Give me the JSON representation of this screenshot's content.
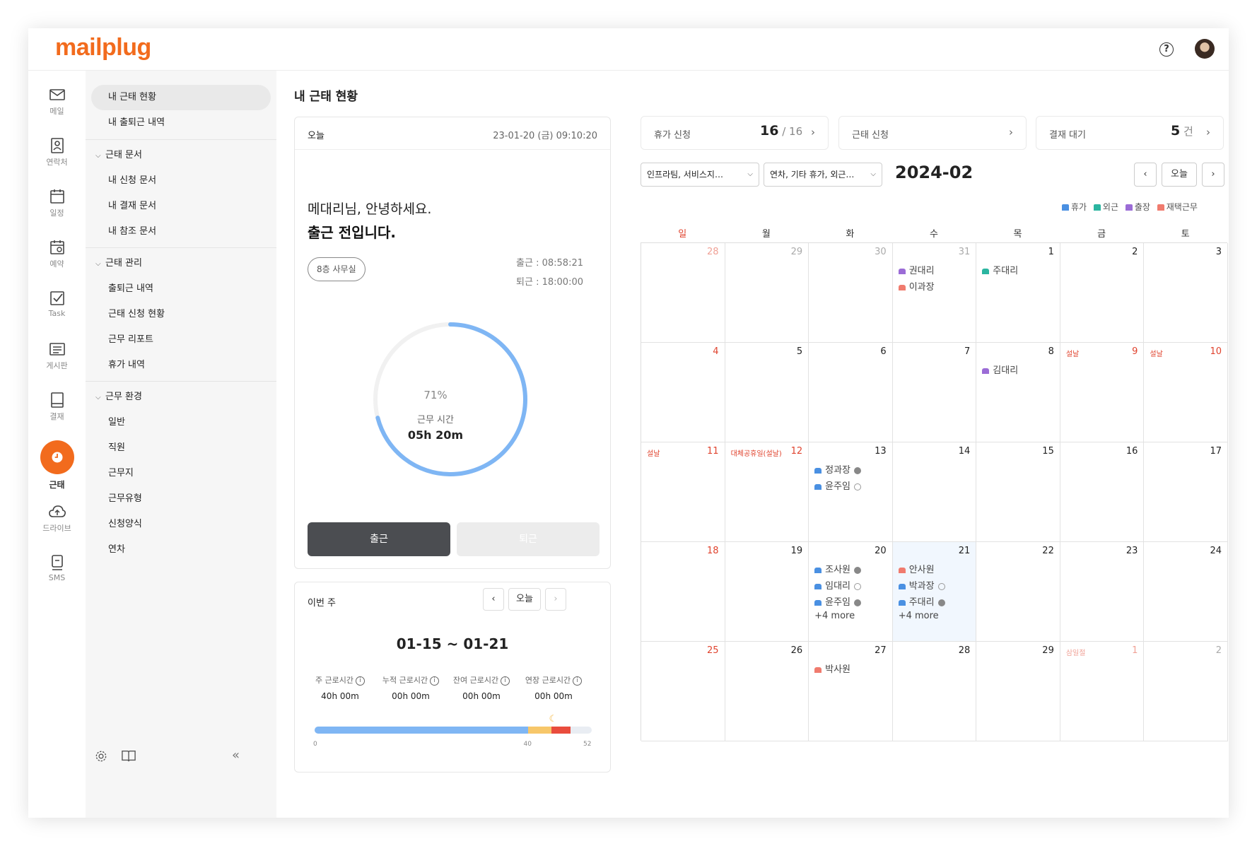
{
  "app": {
    "logo": "mailplug"
  },
  "rail": [
    {
      "label": "메일",
      "icon": "mail-icon"
    },
    {
      "label": "연락처",
      "icon": "contacts-icon"
    },
    {
      "label": "일정",
      "icon": "calendar-icon"
    },
    {
      "label": "예약",
      "icon": "reservation-icon"
    },
    {
      "label": "Task",
      "icon": "task-icon"
    },
    {
      "label": "게시판",
      "icon": "board-icon"
    },
    {
      "label": "결재",
      "icon": "approval-icon"
    },
    {
      "label": "근태",
      "icon": "clock-icon"
    },
    {
      "label": "드라이브",
      "icon": "cloud-icon"
    },
    {
      "label": "SMS",
      "icon": "sms-icon"
    }
  ],
  "subnav": {
    "top": [
      "내 근태 현황",
      "내 출퇴근 내역"
    ],
    "groups": [
      {
        "title": "근태 문서",
        "items": [
          "내 신청 문서",
          "내 결재 문서",
          "내 참조 문서"
        ]
      },
      {
        "title": "근태 관리",
        "items": [
          "출퇴근 내역",
          "근태 신청 현황",
          "근무 리포트",
          "휴가 내역"
        ]
      },
      {
        "title": "근무 환경",
        "items": [
          "일반",
          "직원",
          "근무지",
          "근무유형",
          "신청양식",
          "연차"
        ]
      }
    ]
  },
  "page": {
    "title": "내 근태 현황"
  },
  "today": {
    "label": "오늘",
    "datetime": "23-01-20 (금) 09:10:20",
    "greeting": "메대리님, 안녕하세요.",
    "status": "출근 전입니다.",
    "location": "8층 사무실",
    "clock_in": "출근 : 08:58:21",
    "clock_out": "퇴근 : 18:00:00",
    "progress_pct": 71,
    "progress_text": "71%",
    "work_label": "근무 시간",
    "work_value": "05h 20m",
    "btn_in": "출근",
    "btn_out": "퇴근"
  },
  "week": {
    "label": "이번 주",
    "today_btn": "오늘",
    "range": "01-15 ~ 01-21",
    "stats": [
      {
        "label": "주 근로시간",
        "value": "40h 00m"
      },
      {
        "label": "누적 근로시간",
        "value": "00h 00m"
      },
      {
        "label": "잔여 근로시간",
        "value": "00h 00m"
      },
      {
        "label": "연장 근로시간",
        "value": "00h 00m"
      }
    ],
    "bar": {
      "max": 52,
      "fill": 40,
      "extra1": 4.5,
      "extra2": 3.5
    },
    "ticks": [
      "0",
      "40",
      "52"
    ]
  },
  "summary": {
    "leave": {
      "label": "휴가 신청",
      "num": "16",
      "sub": " / 16"
    },
    "attendance": {
      "label": "근태 신청"
    },
    "pending": {
      "label": "결재 대기",
      "num": "5",
      "sub": " 건"
    }
  },
  "calendar": {
    "filter1": "인프라팀, 서비스지…",
    "filter2": "연차, 기타 휴가, 외근…",
    "month": "2024-02",
    "today_btn": "오늘",
    "legend": [
      {
        "label": "휴가",
        "color": "#4a90e2"
      },
      {
        "label": "외근",
        "color": "#2bb5a0"
      },
      {
        "label": "출장",
        "color": "#9b6cd6"
      },
      {
        "label": "재택근무",
        "color": "#f07b6e"
      }
    ],
    "dow": [
      "일",
      "월",
      "화",
      "수",
      "목",
      "금",
      "토"
    ],
    "weeks": [
      [
        {
          "d": "28",
          "s": "gray-red"
        },
        {
          "d": "29",
          "s": "gray"
        },
        {
          "d": "30",
          "s": "gray"
        },
        {
          "d": "31",
          "s": "gray",
          "events": [
            {
              "name": "권대리",
              "type": "출장"
            },
            {
              "name": "이과장",
              "type": "재택근무"
            }
          ]
        },
        {
          "d": "1",
          "events": [
            {
              "name": "주대리",
              "type": "외근"
            }
          ]
        },
        {
          "d": "2"
        },
        {
          "d": "3"
        }
      ],
      [
        {
          "d": "4",
          "s": "red"
        },
        {
          "d": "5"
        },
        {
          "d": "6"
        },
        {
          "d": "7"
        },
        {
          "d": "8",
          "events": [
            {
              "name": "김대리",
              "type": "출장"
            }
          ]
        },
        {
          "d": "9",
          "s": "red",
          "holiday": "설날"
        },
        {
          "d": "10",
          "s": "red",
          "holiday": "설날"
        }
      ],
      [
        {
          "d": "11",
          "s": "red",
          "holiday": "설날"
        },
        {
          "d": "12",
          "s": "red",
          "holiday": "대체공휴일(설날)"
        },
        {
          "d": "13",
          "events": [
            {
              "name": "정과장",
              "type": "휴가",
              "clock": "filled"
            },
            {
              "name": "윤주임",
              "type": "휴가",
              "clock": "outline"
            }
          ]
        },
        {
          "d": "14"
        },
        {
          "d": "15"
        },
        {
          "d": "16"
        },
        {
          "d": "17"
        }
      ],
      [
        {
          "d": "18",
          "s": "red"
        },
        {
          "d": "19"
        },
        {
          "d": "20",
          "events": [
            {
              "name": "조사원",
              "type": "휴가",
              "clock": "filled"
            },
            {
              "name": "임대리",
              "type": "휴가",
              "clock": "outline"
            },
            {
              "name": "윤주임",
              "type": "휴가",
              "clock": "filled"
            }
          ],
          "more": "+4 more"
        },
        {
          "d": "21",
          "today": true,
          "events": [
            {
              "name": "안사원",
              "type": "재택근무"
            },
            {
              "name": "박과장",
              "type": "휴가",
              "clock": "outline"
            },
            {
              "name": "주대리",
              "type": "휴가",
              "clock": "filled"
            }
          ],
          "more": "+4 more"
        },
        {
          "d": "22"
        },
        {
          "d": "23"
        },
        {
          "d": "24"
        }
      ],
      [
        {
          "d": "25",
          "s": "red"
        },
        {
          "d": "26"
        },
        {
          "d": "27",
          "events": [
            {
              "name": "박사원",
              "type": "재택근무"
            }
          ]
        },
        {
          "d": "28"
        },
        {
          "d": "29"
        },
        {
          "d": "1",
          "s": "gray-red",
          "holiday": "삼일절"
        },
        {
          "d": "2",
          "s": "gray"
        }
      ]
    ]
  }
}
